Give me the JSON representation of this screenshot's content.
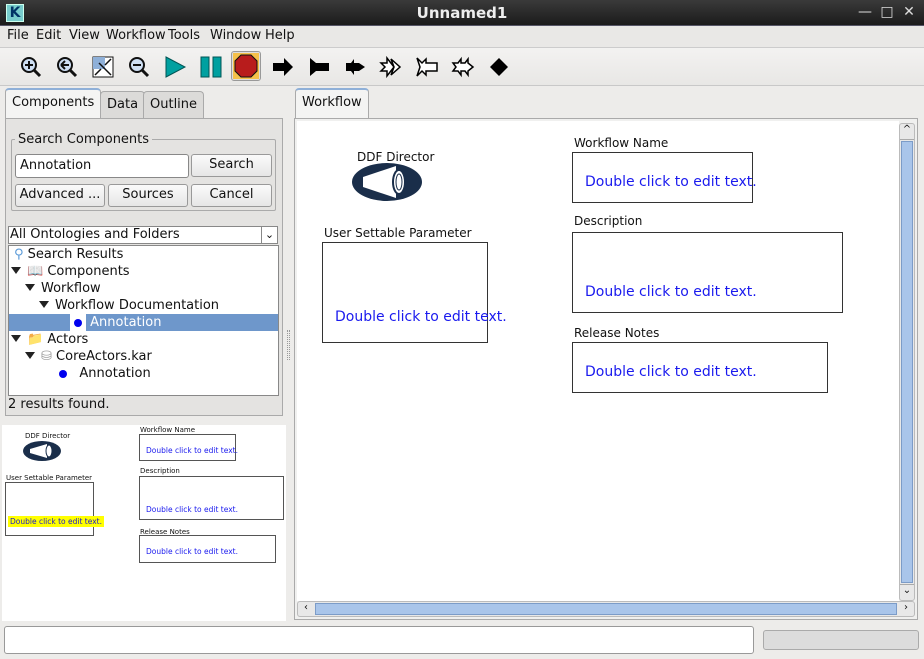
{
  "window": {
    "title": "Unnamed1",
    "app_icon": "K"
  },
  "menu": [
    {
      "label": "File"
    },
    {
      "label": "Edit"
    },
    {
      "label": "View"
    },
    {
      "label": "Workflow"
    },
    {
      "label": "Tools"
    },
    {
      "label": "Window"
    },
    {
      "label": "Help"
    }
  ],
  "toolbar": [
    "zoom-in-icon",
    "zoom-reset-icon",
    "zoom-fit-icon",
    "zoom-out-icon",
    "run-icon",
    "pause-icon",
    "stop-icon",
    "step-arrow-icon",
    "step-flag-icon",
    "step-cross-icon",
    "outline-double-arrow-icon",
    "outline-flag-arrow-icon",
    "outline-double-cross-icon",
    "diamond-icon"
  ],
  "left_tabs": [
    {
      "label": "Components"
    },
    {
      "label": "Data"
    },
    {
      "label": "Outline"
    }
  ],
  "search": {
    "group_label": "Search Components",
    "query": "Annotation",
    "search_label": "Search",
    "advanced_label": "Advanced ...",
    "sources_label": "Sources",
    "cancel_label": "Cancel"
  },
  "ontology_select": {
    "value": "All Ontologies and Folders"
  },
  "tree": [
    {
      "label": "Search Results"
    },
    {
      "label": "Components"
    },
    {
      "label": "Workflow"
    },
    {
      "label": "Workflow Documentation"
    },
    {
      "label": "Annotation"
    },
    {
      "label": "Actors"
    },
    {
      "label": "CoreActors.kar"
    },
    {
      "label": "Annotation"
    }
  ],
  "results_status": "2 results found.",
  "main_tab": "Workflow",
  "canvas": {
    "director": "DDF Director",
    "user_param_label": "User Settable Parameter",
    "workflow_name_label": "Workflow Name",
    "description_label": "Description",
    "release_notes_label": "Release Notes",
    "placeholder": "Double click to edit text."
  },
  "colors": {
    "accent": "#1a1aee",
    "selection": "#6e97cb",
    "highlight": "#ffff00",
    "stop": "#b81c1c",
    "run": "#00a0a0"
  }
}
